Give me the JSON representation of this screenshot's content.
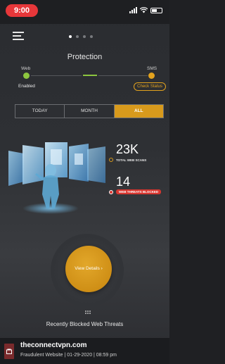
{
  "status_bar": {
    "time": "9:00"
  },
  "header": {
    "title": "Protection",
    "pager_count": 4,
    "pager_active": 0
  },
  "protection": {
    "web_label": "Web",
    "sms_label": "SMS",
    "web_status": "Enabled",
    "check_status_label": "Check Status"
  },
  "tabs": [
    {
      "label": "TODAY",
      "active": false
    },
    {
      "label": "MONTH",
      "active": false
    },
    {
      "label": "ALL",
      "active": true
    }
  ],
  "stats": {
    "web_scans_value": "23K",
    "web_scans_label": "TOTAL WEB SCANS",
    "threats_value": "14",
    "threats_label": "WEB THREATS BLOCKED"
  },
  "view_details_label": "View Details ›",
  "recent": {
    "title": "Recently Blocked Web Threats",
    "items": [
      {
        "domain": "theconnectvpn.com",
        "meta": "Fraudulent Website | 01-29-2020 | 08:59 pm"
      }
    ]
  },
  "colors": {
    "accent": "#d89a1c",
    "enabled": "#8cc63f",
    "danger": "#d8362f"
  }
}
